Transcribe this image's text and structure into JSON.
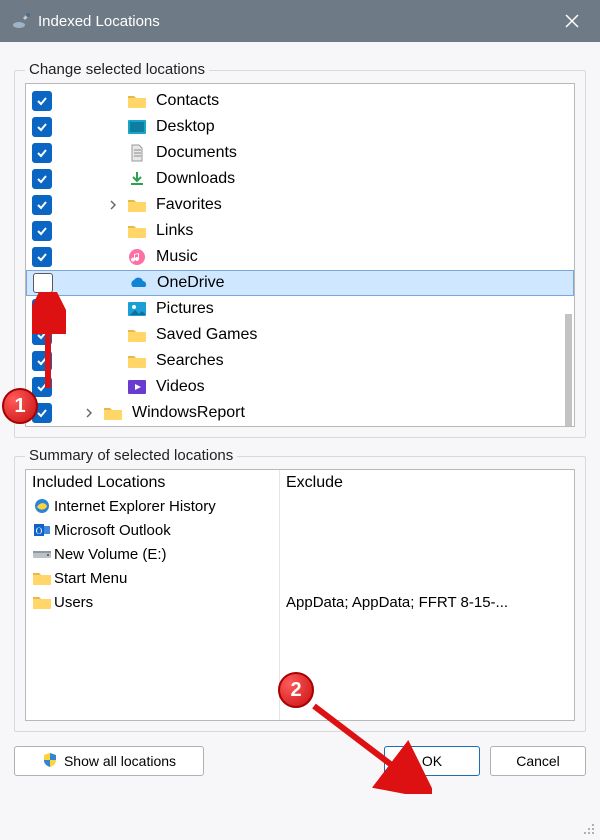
{
  "window": {
    "title": "Indexed Locations"
  },
  "groups": {
    "change": "Change selected locations",
    "summary": "Summary of selected locations"
  },
  "tree": {
    "items": [
      {
        "label": "Contacts",
        "checked": true,
        "indent": 1,
        "expander": "none",
        "selected": false,
        "icon": "folder"
      },
      {
        "label": "Desktop",
        "checked": true,
        "indent": 1,
        "expander": "none",
        "selected": false,
        "icon": "desktop"
      },
      {
        "label": "Documents",
        "checked": true,
        "indent": 1,
        "expander": "none",
        "selected": false,
        "icon": "document"
      },
      {
        "label": "Downloads",
        "checked": true,
        "indent": 1,
        "expander": "none",
        "selected": false,
        "icon": "download"
      },
      {
        "label": "Favorites",
        "checked": true,
        "indent": 1,
        "expander": "closed",
        "selected": false,
        "icon": "folder"
      },
      {
        "label": "Links",
        "checked": true,
        "indent": 1,
        "expander": "none",
        "selected": false,
        "icon": "folder"
      },
      {
        "label": "Music",
        "checked": true,
        "indent": 1,
        "expander": "none",
        "selected": false,
        "icon": "music"
      },
      {
        "label": "OneDrive",
        "checked": false,
        "indent": 1,
        "expander": "none",
        "selected": true,
        "icon": "onedrive"
      },
      {
        "label": "Pictures",
        "checked": true,
        "indent": 1,
        "expander": "none",
        "selected": false,
        "icon": "pictures"
      },
      {
        "label": "Saved Games",
        "checked": true,
        "indent": 1,
        "expander": "none",
        "selected": false,
        "icon": "folder"
      },
      {
        "label": "Searches",
        "checked": true,
        "indent": 1,
        "expander": "none",
        "selected": false,
        "icon": "folder"
      },
      {
        "label": "Videos",
        "checked": true,
        "indent": 1,
        "expander": "none",
        "selected": false,
        "icon": "videos"
      },
      {
        "label": "WindowsReport",
        "checked": true,
        "indent": 0,
        "expander": "closed",
        "selected": false,
        "icon": "folder"
      }
    ]
  },
  "summary": {
    "headers": {
      "included": "Included Locations",
      "exclude": "Exclude"
    },
    "rows": [
      {
        "label": "Internet Explorer History",
        "icon": "ie",
        "exclude": ""
      },
      {
        "label": "Microsoft Outlook",
        "icon": "outlook",
        "exclude": ""
      },
      {
        "label": "New Volume (E:)",
        "icon": "drive",
        "exclude": ""
      },
      {
        "label": "Start Menu",
        "icon": "folder",
        "exclude": ""
      },
      {
        "label": "Users",
        "icon": "folder",
        "exclude": "AppData; AppData; FFRT 8-15-..."
      }
    ]
  },
  "buttons": {
    "showall": "Show all locations",
    "ok": "OK",
    "cancel": "Cancel"
  },
  "annotations": {
    "badge1": "1",
    "badge2": "2"
  }
}
